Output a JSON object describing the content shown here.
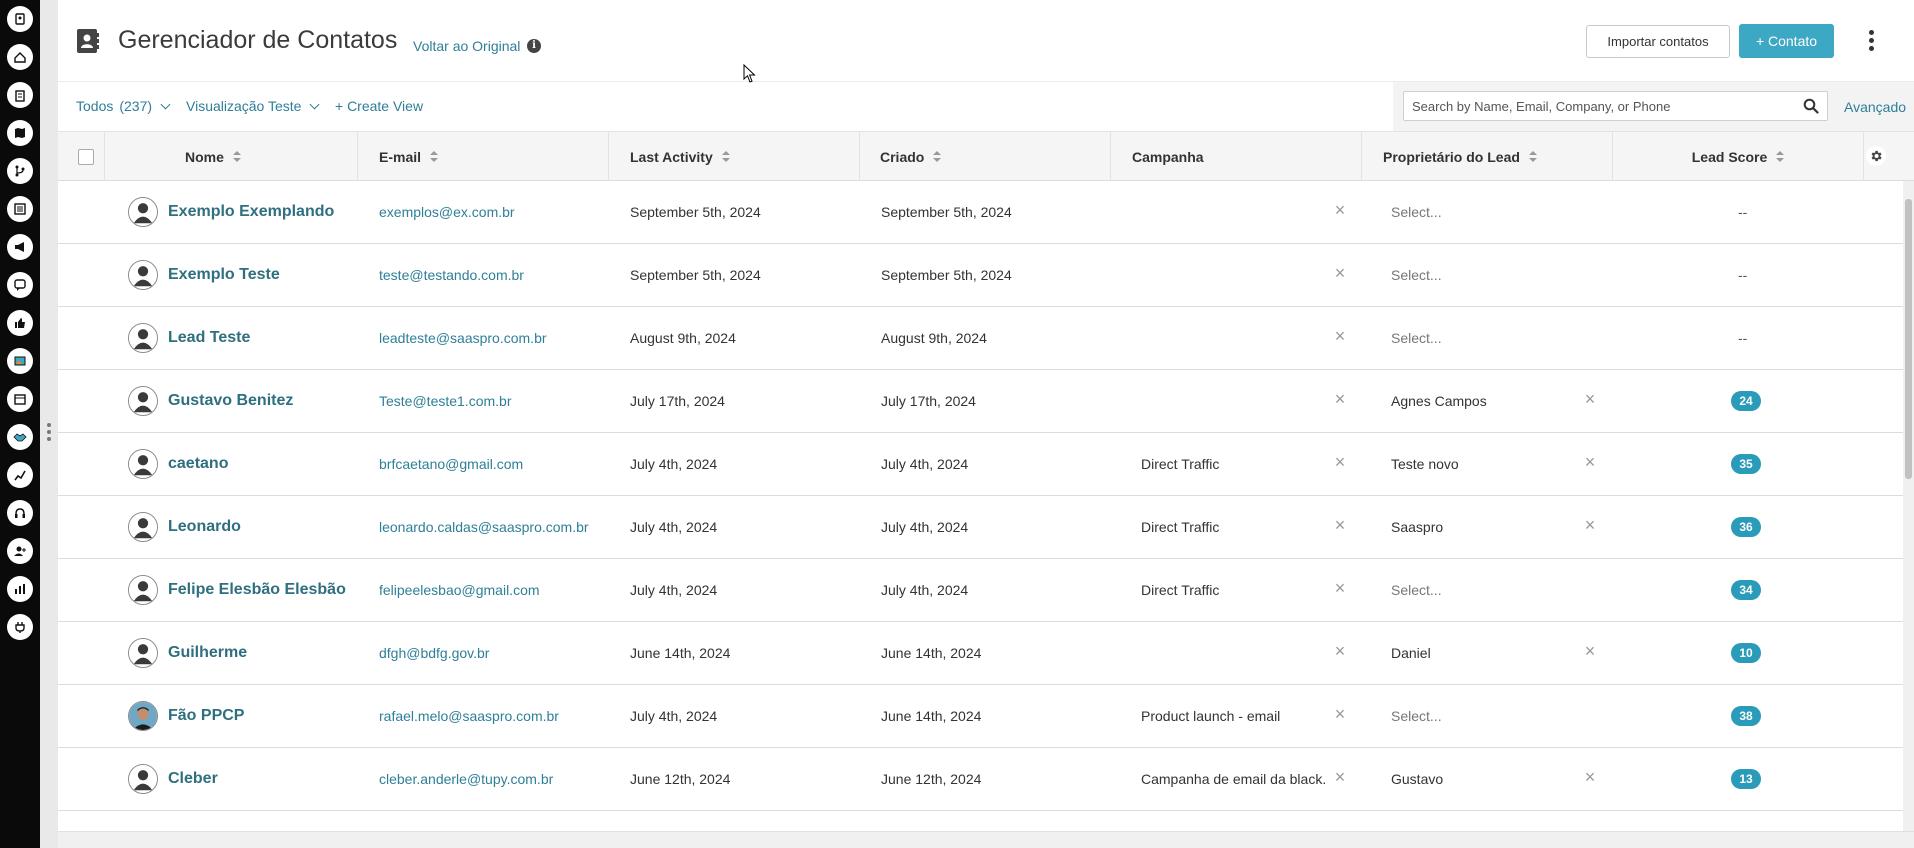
{
  "header": {
    "title": "Gerenciador de Contatos",
    "back_link": "Voltar ao Original",
    "info_glyph": "i",
    "import_button": "Importar contatos",
    "add_contact_button": "+ Contato"
  },
  "filters": {
    "all_label": "Todos",
    "all_count": "(237)",
    "view_label": "Visualização Teste",
    "create_view": "+ Create View",
    "search_placeholder": "Search by Name, Email, Company, or Phone",
    "advanced_link": "Avançado"
  },
  "columns": {
    "name": "Nome",
    "email": "E-mail",
    "last_activity": "Last Activity",
    "created": "Criado",
    "campaign": "Campanha",
    "owner": "Proprietário do Lead",
    "lead_score": "Lead Score"
  },
  "select_placeholder": "Select...",
  "clear_glyph": "×",
  "rows": [
    {
      "name": "Exemplo Exemplando",
      "email": "exemplos@ex.com.br",
      "last_activity": "September 5th, 2024",
      "created": "September 5th, 2024",
      "campaign": "",
      "owner": "",
      "score": "--",
      "avatar": "default"
    },
    {
      "name": "Exemplo Teste",
      "email": "teste@testando.com.br",
      "last_activity": "September 5th, 2024",
      "created": "September 5th, 2024",
      "campaign": "",
      "owner": "",
      "score": "--",
      "avatar": "default"
    },
    {
      "name": "Lead Teste",
      "email": "leadteste@saaspro.com.br",
      "last_activity": "August 9th, 2024",
      "created": "August 9th, 2024",
      "campaign": "",
      "owner": "",
      "score": "--",
      "avatar": "default"
    },
    {
      "name": "Gustavo Benitez",
      "email": "Teste@teste1.com.br",
      "last_activity": "July 17th, 2024",
      "created": "July 17th, 2024",
      "campaign": "",
      "owner": "Agnes Campos",
      "score": "24",
      "avatar": "default"
    },
    {
      "name": "caetano",
      "email": "brfcaetano@gmail.com",
      "last_activity": "July 4th, 2024",
      "created": "July 4th, 2024",
      "campaign": "Direct Traffic",
      "owner": "Teste novo",
      "score": "35",
      "avatar": "default"
    },
    {
      "name": "Leonardo",
      "email": "leonardo.caldas@saaspro.com.br",
      "last_activity": "July 4th, 2024",
      "created": "July 4th, 2024",
      "campaign": "Direct Traffic",
      "owner": "Saaspro",
      "score": "36",
      "avatar": "default"
    },
    {
      "name": "Felipe Elesbão Elesbão",
      "email": "felipeelesbao@gmail.com",
      "last_activity": "July 4th, 2024",
      "created": "July 4th, 2024",
      "campaign": "Direct Traffic",
      "owner": "",
      "score": "34",
      "avatar": "default"
    },
    {
      "name": "Guilherme",
      "email": "dfgh@bdfg.gov.br",
      "last_activity": "June 14th, 2024",
      "created": "June 14th, 2024",
      "campaign": "",
      "owner": "Daniel",
      "score": "10",
      "avatar": "default"
    },
    {
      "name": "Fão PPCP",
      "email": "rafael.melo@saaspro.com.br",
      "last_activity": "July 4th, 2024",
      "created": "June 14th, 2024",
      "campaign": "Product launch - email",
      "owner": "",
      "score": "38",
      "avatar": "photo"
    },
    {
      "name": "Cleber",
      "email": "cleber.anderle@tupy.com.br",
      "last_activity": "June 12th, 2024",
      "created": "June 12th, 2024",
      "campaign": "Campanha de email da black...",
      "owner": "Gustavo",
      "score": "13",
      "avatar": "default"
    }
  ],
  "rail_icons": [
    "contact-book-icon",
    "inbox-icon",
    "clipboard-icon",
    "map-icon",
    "branch-icon",
    "list-icon",
    "megaphone-icon",
    "chat-icon",
    "thumbs-up-icon",
    "image-icon",
    "calendar-icon",
    "handshake-icon",
    "trend-chart-icon",
    "headset-icon",
    "add-user-icon",
    "bar-chart-icon",
    "plug-icon"
  ],
  "colors": {
    "accent": "#3da8c4",
    "link": "#2f7f98",
    "badge": "#2a9bb8",
    "rail": "#0a0a0a"
  }
}
